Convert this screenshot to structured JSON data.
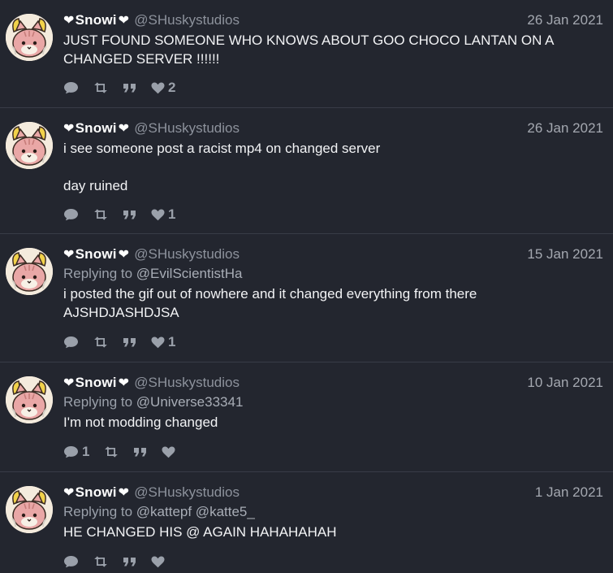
{
  "tweets": [
    {
      "name": "Snowi",
      "handle": "@SHuskystudios",
      "date": "26 Jan 2021",
      "reply_to": "",
      "reply_targets": "",
      "text": "JUST FOUND SOMEONE WHO KNOWS ABOUT GOO CHOCO LANTAN ON A\nCHANGED SERVER !!!!!!",
      "reply_count": "",
      "like_count": "2"
    },
    {
      "name": "Snowi",
      "handle": "@SHuskystudios",
      "date": "26 Jan 2021",
      "reply_to": "",
      "reply_targets": "",
      "text": "i see someone post a racist mp4 on changed server\n\nday ruined",
      "reply_count": "",
      "like_count": "1"
    },
    {
      "name": "Snowi",
      "handle": "@SHuskystudios",
      "date": "15 Jan 2021",
      "reply_to": "Replying to",
      "reply_targets": "@EvilScientistHa",
      "text": "i posted the gif out of nowhere and it changed everything from there\nAJSHDJASHDJSA",
      "reply_count": "",
      "like_count": "1"
    },
    {
      "name": "Snowi",
      "handle": "@SHuskystudios",
      "date": "10 Jan 2021",
      "reply_to": "Replying to",
      "reply_targets": "@Universe33341",
      "text": "I'm not modding changed",
      "reply_count": "1",
      "like_count": ""
    },
    {
      "name": "Snowi",
      "handle": "@SHuskystudios",
      "date": "1 Jan 2021",
      "reply_to": "Replying to",
      "reply_targets": "@kattepf @katte5_",
      "text": "HE CHANGED HIS @ AGAIN HAHAHAHAH",
      "reply_count": "",
      "like_count": ""
    }
  ],
  "icons": {
    "name_decoration": "heart-icon",
    "reply": "speech-bubble-icon",
    "retweet": "retweet-icon",
    "quote": "quote-icon",
    "like": "heart-icon"
  },
  "colors": {
    "background": "#23262f",
    "divider": "#383c47",
    "name": "#ffffff",
    "muted": "#9aa0aa"
  }
}
